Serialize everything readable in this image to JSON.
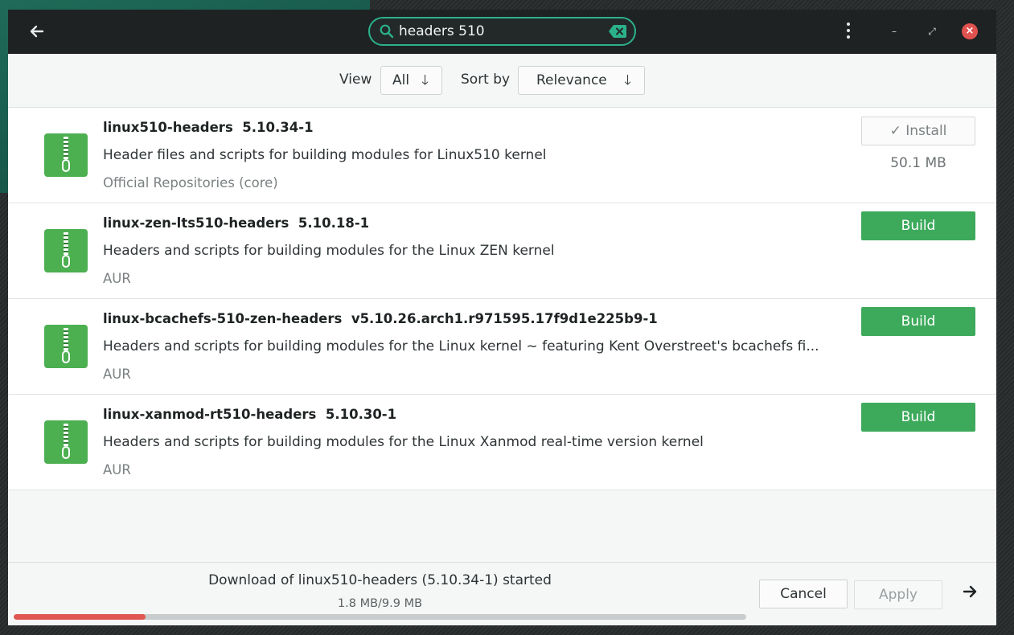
{
  "header": {
    "search_value": "headers 510",
    "search_placeholder": "",
    "accent_color": "#2bb28a"
  },
  "toolbar": {
    "view_label": "View",
    "view_value": "All",
    "sort_label": "Sort by",
    "sort_value": "Relevance"
  },
  "packages": [
    {
      "name": "linux510-headers",
      "version": "5.10.34-1",
      "description": "Header files and scripts for building modules for Linux510 kernel",
      "repo": "Official Repositories (core)",
      "action_label": "Install",
      "action_state": "installed",
      "size": "50.1 MB",
      "icon": "package-zip-icon"
    },
    {
      "name": "linux-zen-lts510-headers",
      "version": "5.10.18-1",
      "description": "Headers and scripts for building modules for the Linux ZEN kernel",
      "repo": "AUR",
      "action_label": "Build",
      "icon": "package-zip-icon"
    },
    {
      "name": "linux-bcachefs-510-zen-headers",
      "version": "v5.10.26.arch1.r971595.17f9d1e225b9-1",
      "description": "Headers and scripts for building modules for the Linux kernel ~ featuring Kent Overstreet's bcachefs fi...",
      "repo": "AUR",
      "action_label": "Build",
      "icon": "package-zip-icon"
    },
    {
      "name": "linux-xanmod-rt510-headers",
      "version": "5.10.30-1",
      "description": "Headers and scripts for building modules for the Linux Xanmod real-time version kernel",
      "repo": "AUR",
      "action_label": "Build",
      "icon": "package-zip-icon"
    }
  ],
  "bottombar": {
    "status": "Download of linux510-headers (5.10.34-1) started",
    "progress_text": "1.8 MB/9.9 MB",
    "progress_fraction": 0.18,
    "cancel_label": "Cancel",
    "apply_label": "Apply",
    "progress_color": "#e05652"
  }
}
